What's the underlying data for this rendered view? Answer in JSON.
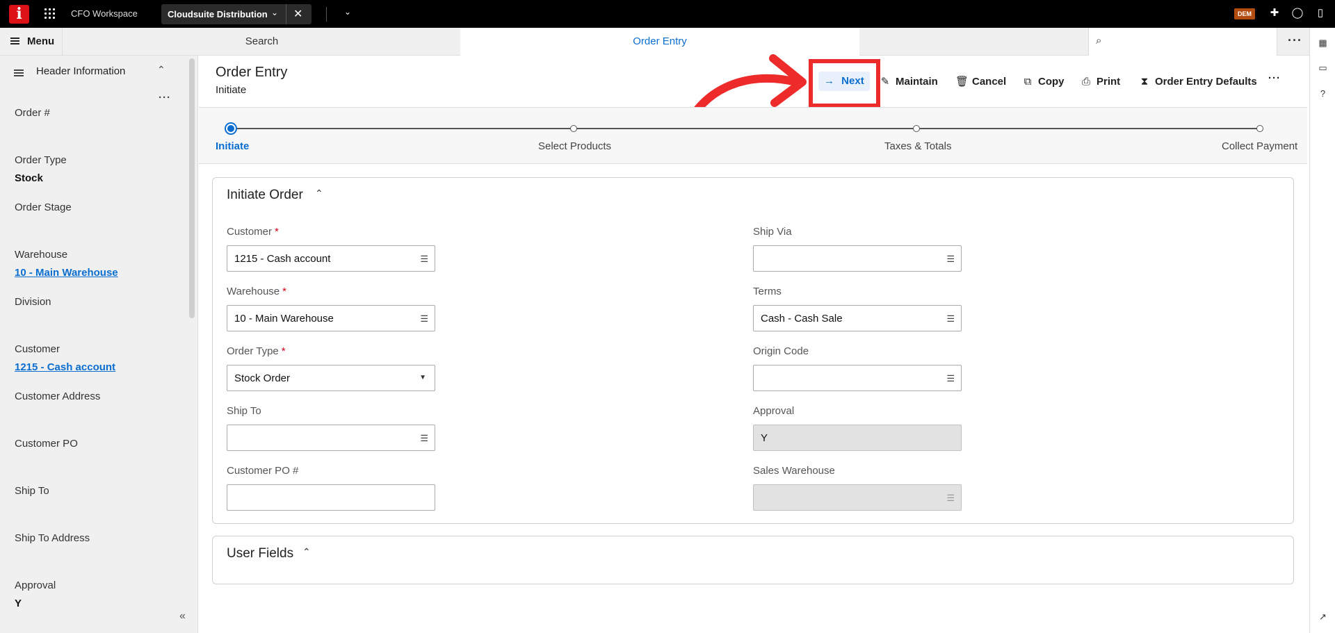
{
  "topbar": {
    "logo": "i",
    "workspace": "CFO Workspace",
    "active_tab": "Cloudsuite Distribution",
    "badge": "DEM"
  },
  "navbar": {
    "menu_label": "Menu",
    "tabs": [
      {
        "label": "Search"
      },
      {
        "label": "Order Entry"
      }
    ]
  },
  "sidebar": {
    "title": "Header Information",
    "fields": [
      {
        "label": "Order #",
        "value": ""
      },
      {
        "label": "Order Type",
        "value": "Stock"
      },
      {
        "label": "Order Stage",
        "value": ""
      },
      {
        "label": "Warehouse",
        "value": "10 - Main Warehouse"
      },
      {
        "label": "Division",
        "value": ""
      },
      {
        "label": "Customer",
        "value": "1215 - Cash account"
      },
      {
        "label": "Customer Address",
        "value": ""
      },
      {
        "label": "Customer PO",
        "value": ""
      },
      {
        "label": "Ship To",
        "value": ""
      },
      {
        "label": "Ship To Address",
        "value": ""
      },
      {
        "label": "Approval",
        "value": "Y"
      }
    ]
  },
  "page": {
    "title": "Order Entry",
    "subtitle": "Initiate"
  },
  "toolbar": {
    "next": "Next",
    "maintain": "Maintain",
    "cancel": "Cancel",
    "copy": "Copy",
    "print": "Print",
    "defaults": "Order Entry Defaults"
  },
  "stepper": {
    "steps": [
      "Initiate",
      "Select Products",
      "Taxes & Totals",
      "Collect Payment"
    ],
    "active_index": 0
  },
  "initiate_order": {
    "title": "Initiate Order",
    "customer": {
      "label": "Customer",
      "value": "1215 - Cash account",
      "required": true
    },
    "warehouse": {
      "label": "Warehouse",
      "value": "10 - Main Warehouse",
      "required": true
    },
    "order_type": {
      "label": "Order Type",
      "value": "Stock Order",
      "required": true
    },
    "ship_to": {
      "label": "Ship To",
      "value": ""
    },
    "customer_po": {
      "label": "Customer PO #",
      "value": ""
    },
    "ship_via": {
      "label": "Ship Via",
      "value": ""
    },
    "terms": {
      "label": "Terms",
      "value": "Cash - Cash Sale"
    },
    "origin_code": {
      "label": "Origin Code",
      "value": ""
    },
    "approval": {
      "label": "Approval",
      "value": "Y"
    },
    "sales_warehouse": {
      "label": "Sales Warehouse",
      "value": ""
    }
  },
  "user_fields": {
    "title": "User Fields"
  },
  "colors": {
    "accent": "#0a6ed1",
    "logo_red": "#da1217",
    "annotation_red": "#ee2b2b",
    "badge": "#b34d0f"
  }
}
